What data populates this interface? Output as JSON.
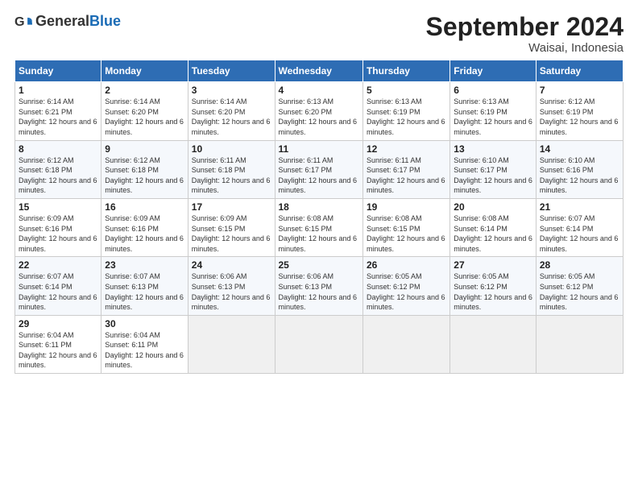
{
  "logo": {
    "general": "General",
    "blue": "Blue"
  },
  "header": {
    "title": "September 2024",
    "location": "Waisai, Indonesia"
  },
  "weekdays": [
    "Sunday",
    "Monday",
    "Tuesday",
    "Wednesday",
    "Thursday",
    "Friday",
    "Saturday"
  ],
  "weeks": [
    [
      {
        "day": 1,
        "sunrise": "6:14 AM",
        "sunset": "6:21 PM",
        "daylight": "12 hours and 6 minutes."
      },
      {
        "day": 2,
        "sunrise": "6:14 AM",
        "sunset": "6:20 PM",
        "daylight": "12 hours and 6 minutes."
      },
      {
        "day": 3,
        "sunrise": "6:14 AM",
        "sunset": "6:20 PM",
        "daylight": "12 hours and 6 minutes."
      },
      {
        "day": 4,
        "sunrise": "6:13 AM",
        "sunset": "6:20 PM",
        "daylight": "12 hours and 6 minutes."
      },
      {
        "day": 5,
        "sunrise": "6:13 AM",
        "sunset": "6:19 PM",
        "daylight": "12 hours and 6 minutes."
      },
      {
        "day": 6,
        "sunrise": "6:13 AM",
        "sunset": "6:19 PM",
        "daylight": "12 hours and 6 minutes."
      },
      {
        "day": 7,
        "sunrise": "6:12 AM",
        "sunset": "6:19 PM",
        "daylight": "12 hours and 6 minutes."
      }
    ],
    [
      {
        "day": 8,
        "sunrise": "6:12 AM",
        "sunset": "6:18 PM",
        "daylight": "12 hours and 6 minutes."
      },
      {
        "day": 9,
        "sunrise": "6:12 AM",
        "sunset": "6:18 PM",
        "daylight": "12 hours and 6 minutes."
      },
      {
        "day": 10,
        "sunrise": "6:11 AM",
        "sunset": "6:18 PM",
        "daylight": "12 hours and 6 minutes."
      },
      {
        "day": 11,
        "sunrise": "6:11 AM",
        "sunset": "6:17 PM",
        "daylight": "12 hours and 6 minutes."
      },
      {
        "day": 12,
        "sunrise": "6:11 AM",
        "sunset": "6:17 PM",
        "daylight": "12 hours and 6 minutes."
      },
      {
        "day": 13,
        "sunrise": "6:10 AM",
        "sunset": "6:17 PM",
        "daylight": "12 hours and 6 minutes."
      },
      {
        "day": 14,
        "sunrise": "6:10 AM",
        "sunset": "6:16 PM",
        "daylight": "12 hours and 6 minutes."
      }
    ],
    [
      {
        "day": 15,
        "sunrise": "6:09 AM",
        "sunset": "6:16 PM",
        "daylight": "12 hours and 6 minutes."
      },
      {
        "day": 16,
        "sunrise": "6:09 AM",
        "sunset": "6:16 PM",
        "daylight": "12 hours and 6 minutes."
      },
      {
        "day": 17,
        "sunrise": "6:09 AM",
        "sunset": "6:15 PM",
        "daylight": "12 hours and 6 minutes."
      },
      {
        "day": 18,
        "sunrise": "6:08 AM",
        "sunset": "6:15 PM",
        "daylight": "12 hours and 6 minutes."
      },
      {
        "day": 19,
        "sunrise": "6:08 AM",
        "sunset": "6:15 PM",
        "daylight": "12 hours and 6 minutes."
      },
      {
        "day": 20,
        "sunrise": "6:08 AM",
        "sunset": "6:14 PM",
        "daylight": "12 hours and 6 minutes."
      },
      {
        "day": 21,
        "sunrise": "6:07 AM",
        "sunset": "6:14 PM",
        "daylight": "12 hours and 6 minutes."
      }
    ],
    [
      {
        "day": 22,
        "sunrise": "6:07 AM",
        "sunset": "6:14 PM",
        "daylight": "12 hours and 6 minutes."
      },
      {
        "day": 23,
        "sunrise": "6:07 AM",
        "sunset": "6:13 PM",
        "daylight": "12 hours and 6 minutes."
      },
      {
        "day": 24,
        "sunrise": "6:06 AM",
        "sunset": "6:13 PM",
        "daylight": "12 hours and 6 minutes."
      },
      {
        "day": 25,
        "sunrise": "6:06 AM",
        "sunset": "6:13 PM",
        "daylight": "12 hours and 6 minutes."
      },
      {
        "day": 26,
        "sunrise": "6:05 AM",
        "sunset": "6:12 PM",
        "daylight": "12 hours and 6 minutes."
      },
      {
        "day": 27,
        "sunrise": "6:05 AM",
        "sunset": "6:12 PM",
        "daylight": "12 hours and 6 minutes."
      },
      {
        "day": 28,
        "sunrise": "6:05 AM",
        "sunset": "6:12 PM",
        "daylight": "12 hours and 6 minutes."
      }
    ],
    [
      {
        "day": 29,
        "sunrise": "6:04 AM",
        "sunset": "6:11 PM",
        "daylight": "12 hours and 6 minutes."
      },
      {
        "day": 30,
        "sunrise": "6:04 AM",
        "sunset": "6:11 PM",
        "daylight": "12 hours and 6 minutes."
      },
      null,
      null,
      null,
      null,
      null
    ]
  ]
}
